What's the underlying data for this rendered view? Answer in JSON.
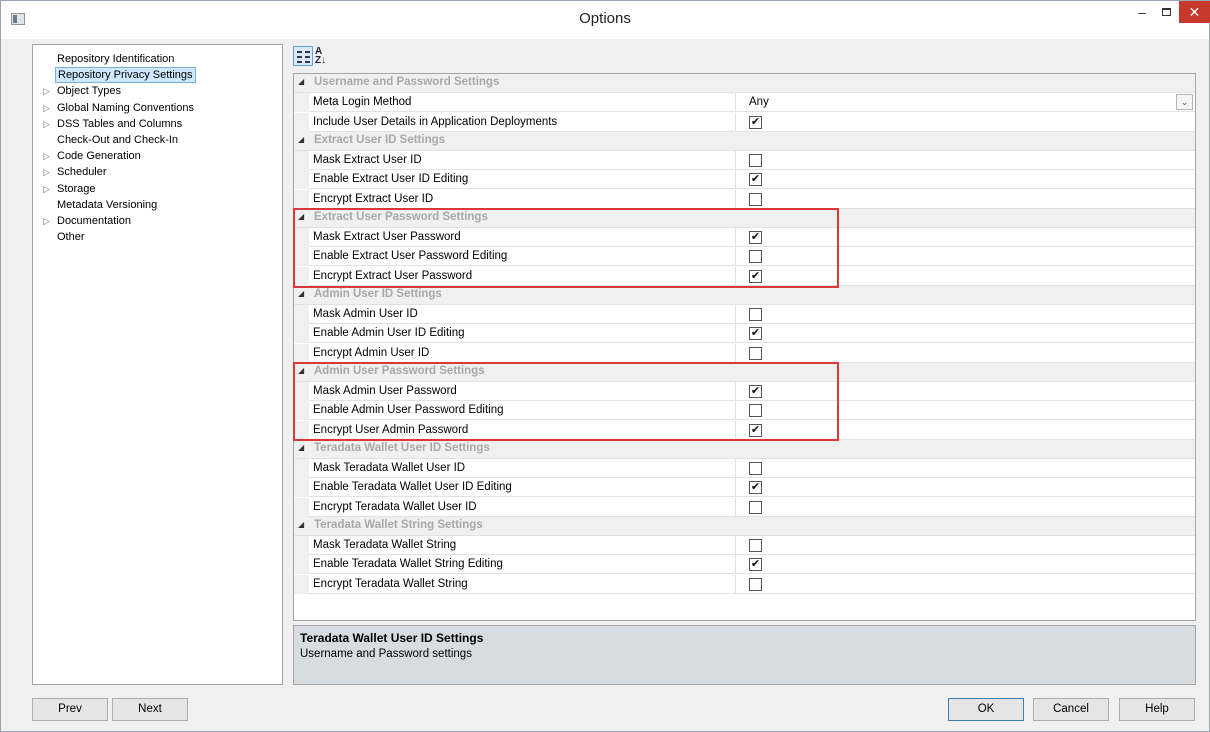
{
  "window": {
    "title": "Options",
    "minimize": "–",
    "close": "✕"
  },
  "tree": {
    "items": [
      {
        "label": "Repository Identification",
        "arrow": ""
      },
      {
        "label": "Repository Privacy Settings",
        "arrow": "",
        "selected": true
      },
      {
        "label": "Object Types",
        "arrow": "▷"
      },
      {
        "label": "Global Naming Conventions",
        "arrow": "▷"
      },
      {
        "label": "DSS Tables and Columns",
        "arrow": "▷"
      },
      {
        "label": "Check-Out and Check-In",
        "arrow": ""
      },
      {
        "label": "Code Generation",
        "arrow": "▷"
      },
      {
        "label": "Scheduler",
        "arrow": "▷"
      },
      {
        "label": "Storage",
        "arrow": "▷"
      },
      {
        "label": "Metadata Versioning",
        "arrow": ""
      },
      {
        "label": "Documentation",
        "arrow": "▷"
      },
      {
        "label": "Other",
        "arrow": ""
      }
    ]
  },
  "toolbar": {
    "categorized_icon": "categorized-icon",
    "alphabetical_icon": "alphabetical-sort-icon",
    "alpha_glyph": "A\nZ↓"
  },
  "grid": {
    "rows": [
      {
        "type": "cat",
        "label": "Username and Password Settings"
      },
      {
        "type": "dropdown",
        "label": "Meta Login Method",
        "value": "Any"
      },
      {
        "type": "check",
        "label": "Include User Details in Application Deployments",
        "checked": true
      },
      {
        "type": "cat",
        "label": "Extract User ID Settings"
      },
      {
        "type": "check",
        "label": "Mask Extract User ID",
        "checked": false
      },
      {
        "type": "check",
        "label": "Enable Extract User ID Editing",
        "checked": true
      },
      {
        "type": "check",
        "label": "Encrypt Extract User ID",
        "checked": false
      },
      {
        "type": "cat",
        "label": "Extract User Password Settings"
      },
      {
        "type": "check",
        "label": "Mask Extract User Password",
        "checked": true
      },
      {
        "type": "check",
        "label": "Enable Extract User Password Editing",
        "checked": false
      },
      {
        "type": "check",
        "label": "Encrypt Extract User Password",
        "checked": true
      },
      {
        "type": "cat",
        "label": "Admin User ID Settings"
      },
      {
        "type": "check",
        "label": "Mask Admin User ID",
        "checked": false
      },
      {
        "type": "check",
        "label": "Enable Admin User ID Editing",
        "checked": true
      },
      {
        "type": "check",
        "label": "Encrypt Admin User ID",
        "checked": false
      },
      {
        "type": "cat",
        "label": "Admin User Password Settings"
      },
      {
        "type": "check",
        "label": "Mask Admin User Password",
        "checked": true
      },
      {
        "type": "check",
        "label": "Enable Admin User Password Editing",
        "checked": false
      },
      {
        "type": "check",
        "label": "Encrypt User Admin Password",
        "checked": true
      },
      {
        "type": "cat",
        "label": "Teradata Wallet User ID Settings"
      },
      {
        "type": "check",
        "label": "Mask Teradata Wallet User ID",
        "checked": false
      },
      {
        "type": "check",
        "label": "Enable Teradata Wallet User ID Editing",
        "checked": true
      },
      {
        "type": "check",
        "label": "Encrypt Teradata Wallet User ID",
        "checked": false
      },
      {
        "type": "cat",
        "label": "Teradata Wallet String Settings"
      },
      {
        "type": "check",
        "label": "Mask Teradata Wallet String",
        "checked": false
      },
      {
        "type": "check",
        "label": "Enable Teradata Wallet String Editing",
        "checked": true
      },
      {
        "type": "check",
        "label": "Encrypt Teradata Wallet String",
        "checked": false
      }
    ]
  },
  "description": {
    "title": "Teradata Wallet User ID Settings",
    "text": "Username and Password settings"
  },
  "buttons": {
    "prev": "Prev",
    "next": "Next",
    "ok": "OK",
    "cancel": "Cancel",
    "help": "Help"
  },
  "colors": {
    "highlight": "#d9393b",
    "close": "#c7392d",
    "selection": "#cde8ff"
  }
}
